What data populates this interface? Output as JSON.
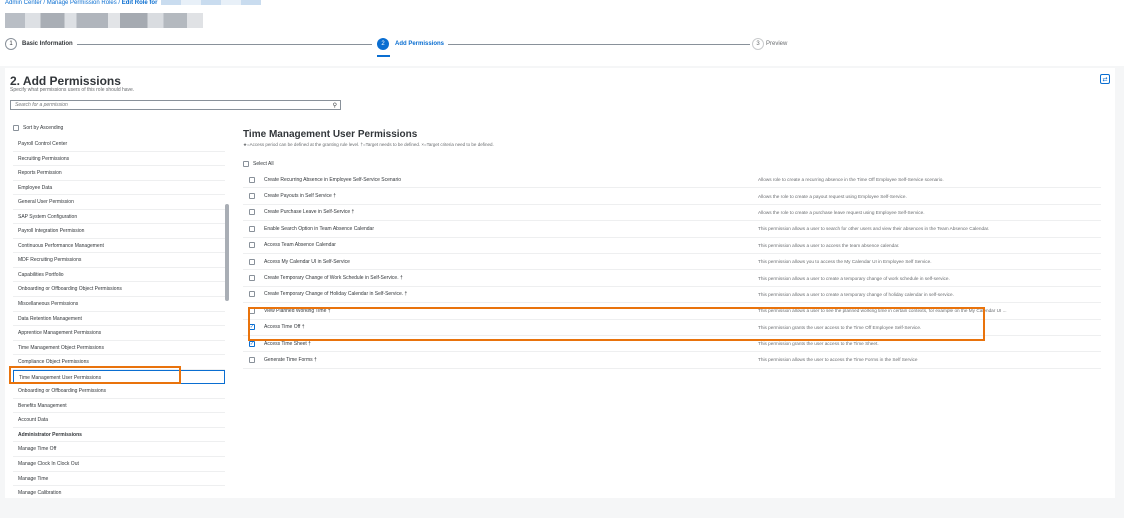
{
  "breadcrumb": {
    "admin_center": "Admin Center",
    "sep1": " / ",
    "manage_roles": "Manage Permission Roles",
    "sep2": " / ",
    "edit_role": "Edit Role for"
  },
  "steps": [
    {
      "number": "1",
      "label": "Basic Information",
      "state": "done"
    },
    {
      "number": "2",
      "label": "Add Permissions",
      "state": "active"
    },
    {
      "number": "3",
      "label": "Preview",
      "state": "pending"
    }
  ],
  "section": {
    "title": "2. Add Permissions",
    "subtitle": "Specify what permissions users of this role should have."
  },
  "search": {
    "placeholder": "Search for a permission"
  },
  "sort_label": "Sort by Ascending",
  "nav_items": [
    {
      "label": "Payroll Control Center"
    },
    {
      "label": "Recruiting Permissions"
    },
    {
      "label": "Reports Permission"
    },
    {
      "label": "Employee Data"
    },
    {
      "label": "General User Permission"
    },
    {
      "label": "SAP System Configuration"
    },
    {
      "label": "Payroll Integration Permission"
    },
    {
      "label": "Continuous Performance Management"
    },
    {
      "label": "MDF Recruiting Permissions"
    },
    {
      "label": "Capabilities Portfolio"
    },
    {
      "label": "Onboarding or Offboarding Object Permissions"
    },
    {
      "label": "Miscellaneous Permissions"
    },
    {
      "label": "Data Retention Management"
    },
    {
      "label": "Apprentice Management Permissions"
    },
    {
      "label": "Time Management Object Permissions"
    },
    {
      "label": "Compliance Object Permissions"
    },
    {
      "label": "Time Management User Permissions",
      "selected": true
    },
    {
      "label": "Onboarding or Offboarding Permissions"
    },
    {
      "label": "Benefits Management"
    },
    {
      "label": "Account Data"
    },
    {
      "label": "Administrator Permissions",
      "header": true
    },
    {
      "label": "Manage Time Off"
    },
    {
      "label": "Manage Clock In Clock Out"
    },
    {
      "label": "Manage Time"
    },
    {
      "label": "Manage Calibration"
    }
  ],
  "permissions": {
    "title": "Time Management User Permissions",
    "legend": "★=Access period can be defined at the granting rule level.  †=Target needs to be defined.  ×=Target criteria need to be defined.",
    "select_all": "Select All",
    "rows": [
      {
        "name": "Create Recurring Absence in Employee Self-Service Scenario",
        "desc": "Allows role to create a recurring absence in the Time Off Employee Self-Service scenario.",
        "checked": false
      },
      {
        "name": "Create Payouts in Self Service †",
        "desc": "Allows the role to create a payout request using Employee Self-Service.",
        "checked": false
      },
      {
        "name": "Create Purchase Leave in Self-Service †",
        "desc": "Allows the role to create a purchase leave request using Employee Self-Service.",
        "checked": false
      },
      {
        "name": "Enable Search Option in Team Absence Calendar",
        "desc": "This permission allows a user to search for other users and view their absences in the Team Absence Calendar.",
        "checked": false
      },
      {
        "name": "Access Team Absence Calendar",
        "desc": "This permission allows a user to access the team absence calendar.",
        "checked": false
      },
      {
        "name": "Access My Calendar UI in Self-Service",
        "desc": "This permission allows you to access the My Calendar UI in Employee Self Service.",
        "checked": false
      },
      {
        "name": "Create Temporary Change of Work Schedule in Self-Service. †",
        "desc": "This permission allows a user to create a temporary change of work schedule in self-service.",
        "checked": false
      },
      {
        "name": "Create Temporary Change of Holiday Calendar in Self-Service. †",
        "desc": "This permission allows a user to create a temporary change of holiday calendar in self-service.",
        "checked": false
      },
      {
        "name": "View Planned Working Time †",
        "desc": "This permission allows a user to see the planned working time in certain contexts, for example on the My Calendar UI ...",
        "checked": false
      },
      {
        "name": "Access Time Off †",
        "desc": "This permission grants the user access to the Time Off Employee Self-Service.",
        "checked": true
      },
      {
        "name": "Access Time Sheet †",
        "desc": "This permission grants the user access to the Time Sheet.",
        "checked": true
      },
      {
        "name": "Generate Time Forms †",
        "desc": "This permission allows the user to access the Time Forms in the Self Service",
        "checked": false
      }
    ]
  },
  "colors": {
    "accent": "#0a6ed1",
    "highlight": "#e9730c"
  },
  "icons": {
    "search": "search-icon",
    "sync": "sync-icon",
    "checkmark": "checkmark-icon"
  }
}
